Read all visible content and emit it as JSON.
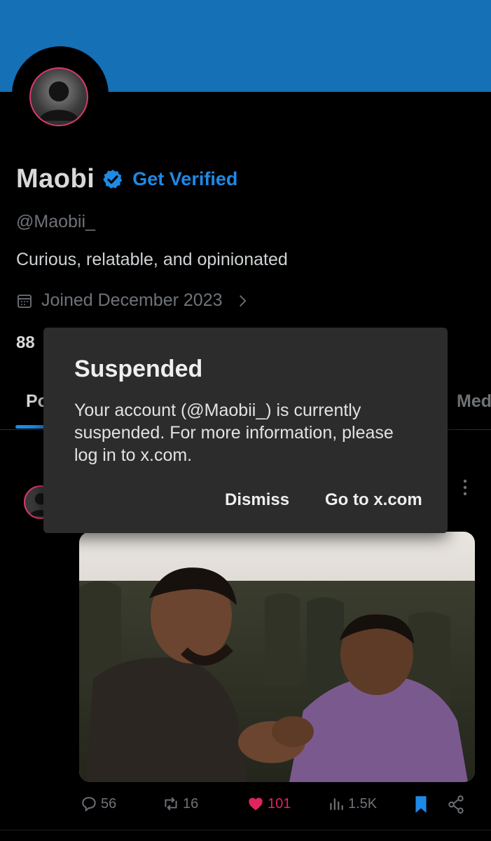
{
  "profile": {
    "name": "Maobi",
    "get_verified": "Get Verified",
    "handle": "@Maobii_",
    "bio": "Curious, relatable, and opinionated",
    "joined": "Joined December 2023",
    "stats_partial": "88"
  },
  "tabs": {
    "left_partial": "Po",
    "right_partial": "Med"
  },
  "post": {
    "replies": "56",
    "reposts": "16",
    "likes": "101",
    "views": "1.5K"
  },
  "dialog": {
    "title": "Suspended",
    "message": "Your account (@Maobii_) is currently suspended. For more information, please log in to x.com.",
    "dismiss_label": "Dismiss",
    "goto_label": "Go to x.com"
  },
  "colors": {
    "banner": "#1670b5",
    "accent": "#1d8ae6",
    "like": "#e0245e",
    "dialog_bg": "#2c2c2c"
  },
  "icons": [
    "verified-badge-icon",
    "calendar-icon",
    "chevron-right-icon",
    "more-vertical-icon",
    "reply-icon",
    "repost-icon",
    "heart-icon",
    "views-icon",
    "bookmark-icon",
    "share-icon"
  ]
}
